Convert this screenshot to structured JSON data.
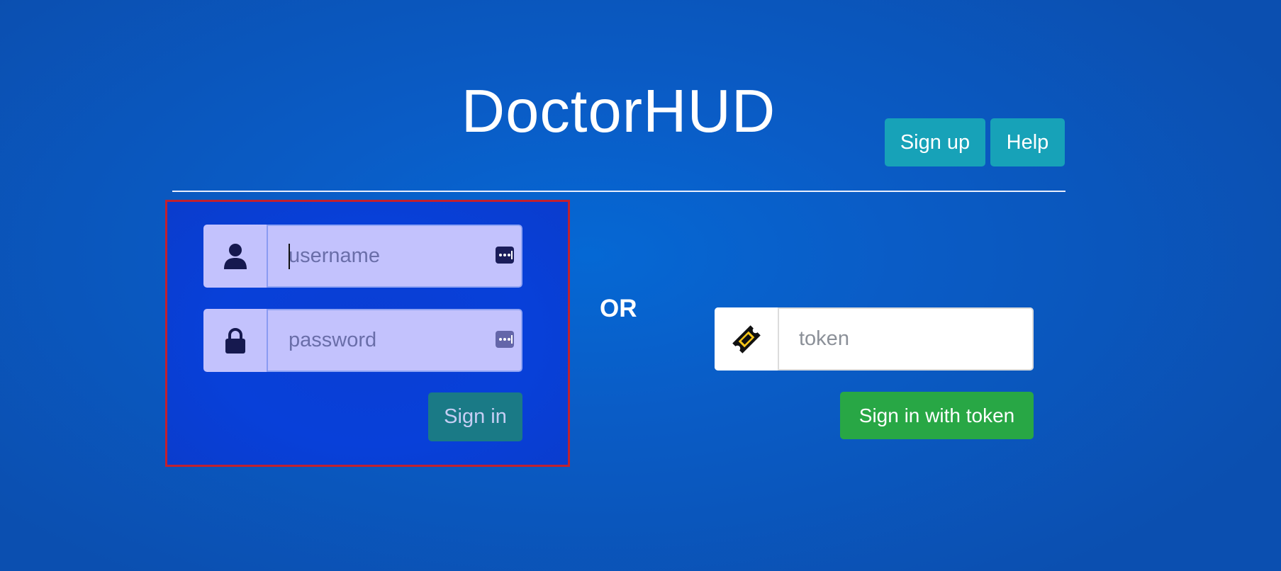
{
  "app": {
    "title": "DoctorHUD"
  },
  "header": {
    "signup_label": "Sign up",
    "help_label": "Help"
  },
  "login": {
    "username_placeholder": "username",
    "username_value": "",
    "password_placeholder": "password",
    "password_value": "",
    "signin_label": "Sign in",
    "user_icon": "user-icon",
    "lock_icon": "lock-icon",
    "password_manager_icon": "password-manager-icon"
  },
  "separator": {
    "or_label": "OR"
  },
  "token": {
    "placeholder": "token",
    "value": "",
    "icon": "ticket-icon",
    "signin_label": "Sign in with token"
  },
  "colors": {
    "background": "#0a5cc6",
    "accent_info": "#17a2b8",
    "success": "#28a745",
    "selection_outline": "#c2202e"
  }
}
